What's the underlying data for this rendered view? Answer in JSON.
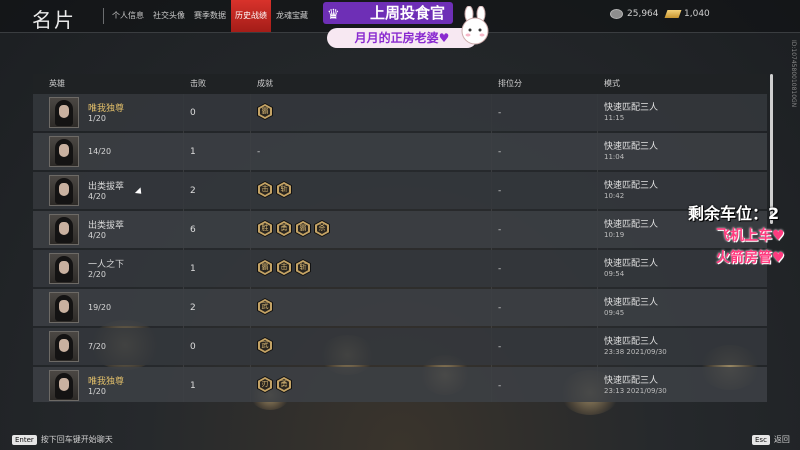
{
  "header": {
    "title": "名片",
    "tabs": [
      {
        "label": "个人信息",
        "active": false
      },
      {
        "label": "社交头像",
        "active": false
      },
      {
        "label": "赛季数据",
        "active": false
      },
      {
        "label": "历史战绩",
        "active": true
      },
      {
        "label": "龙魂宝藏",
        "active": false
      }
    ],
    "currency": [
      {
        "icon": "coin-icon",
        "value": "25,964"
      },
      {
        "icon": "gold-bar-icon",
        "value": "1,040"
      }
    ]
  },
  "banner": {
    "line1": "上周投食官",
    "line2": "月月的正房老婆♥"
  },
  "table": {
    "columns": [
      "英雄",
      "击败",
      "成就",
      "排位分",
      "模式"
    ],
    "rows": [
      {
        "title": "唯我独尊",
        "title_style": "gold",
        "rank": "1/20",
        "kills": "0",
        "achievements": [
          "霸"
        ],
        "score": "-",
        "mode": "快速匹配三人",
        "time": "11:15"
      },
      {
        "title": "",
        "title_style": "none",
        "rank": "14/20",
        "kills": "1",
        "achievements": [],
        "achievement_text": "-",
        "score": "-",
        "mode": "快速匹配三人",
        "time": "11:04"
      },
      {
        "title": "出类拔萃",
        "title_style": "plain",
        "rank": "4/20",
        "kills": "2",
        "achievements": [
          "击",
          "斩"
        ],
        "score": "-",
        "mode": "快速匹配三人",
        "time": "10:42"
      },
      {
        "title": "出类拔萃",
        "title_style": "plain",
        "rank": "4/20",
        "kills": "6",
        "achievements": [
          "胜",
          "勇",
          "霸",
          "杀"
        ],
        "score": "-",
        "mode": "快速匹配三人",
        "time": "10:19"
      },
      {
        "title": "一人之下",
        "title_style": "plain",
        "rank": "2/20",
        "kills": "1",
        "achievements": [
          "霸",
          "击",
          "斩"
        ],
        "score": "-",
        "mode": "快速匹配三人",
        "time": "09:54"
      },
      {
        "title": "",
        "title_style": "none",
        "rank": "19/20",
        "kills": "2",
        "achievements": [
          "武"
        ],
        "score": "-",
        "mode": "快速匹配三人",
        "time": "09:45"
      },
      {
        "title": "",
        "title_style": "none",
        "rank": "7/20",
        "kills": "0",
        "achievements": [
          "武"
        ],
        "score": "-",
        "mode": "快速匹配三人",
        "time": "23:38 2021/09/30"
      },
      {
        "title": "唯我独尊",
        "title_style": "gold",
        "rank": "1/20",
        "kills": "1",
        "achievements": [
          "刃",
          "勇"
        ],
        "score": "-",
        "mode": "快速匹配三人",
        "time": "23:13 2021/09/30"
      }
    ]
  },
  "overlay": {
    "line1": "剩余车位：2",
    "line2": "飞机上车♥",
    "line3": "火箭房管♥"
  },
  "side_id": "ID:1074580010810GN",
  "footer": {
    "enter_key": "Enter",
    "enter_hint": "按下回车键开始聊天",
    "esc_key": "Esc",
    "esc_hint": "返回"
  }
}
